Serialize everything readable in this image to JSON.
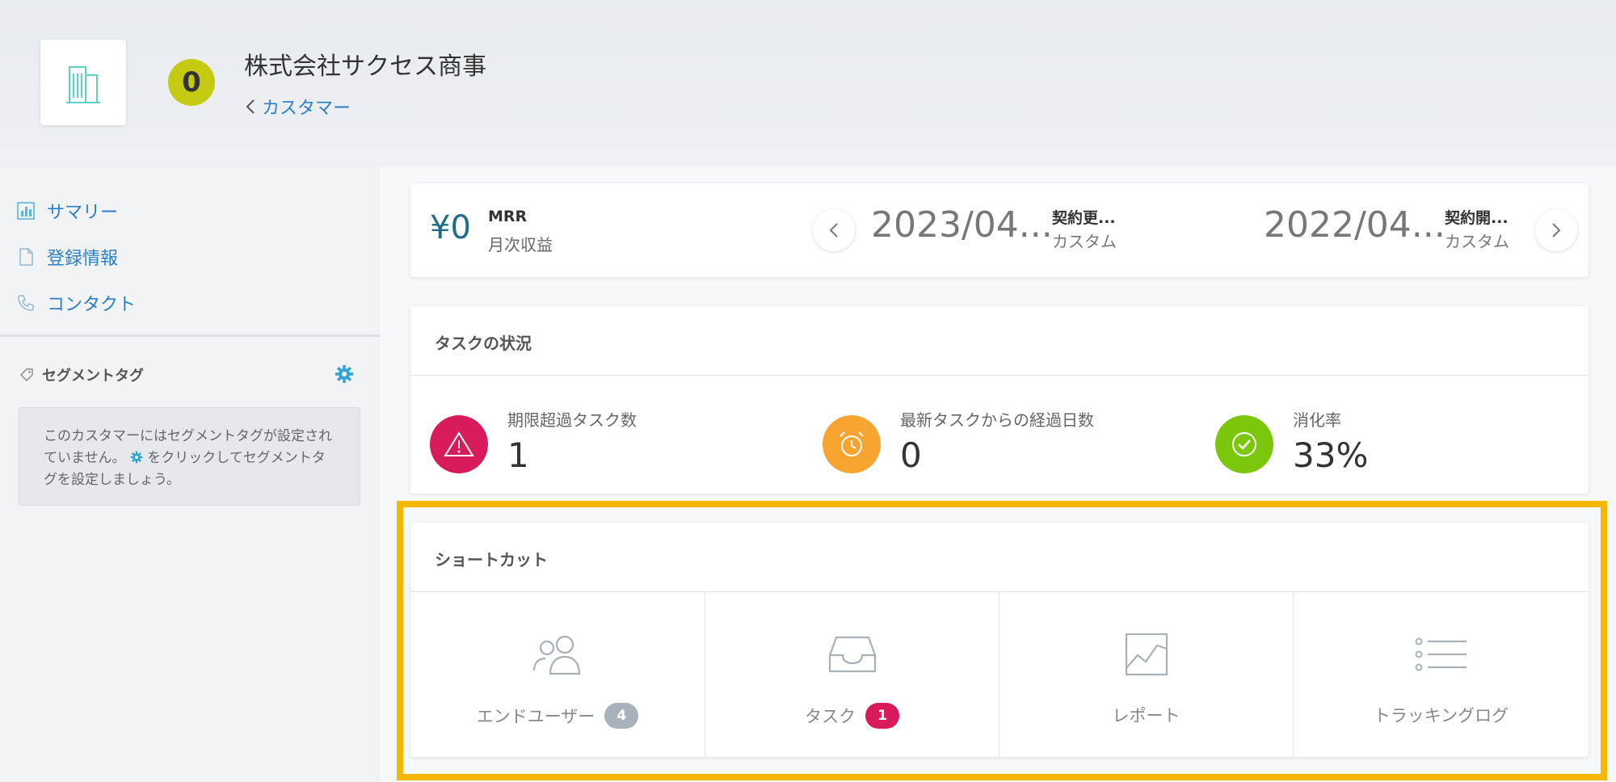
{
  "header": {
    "company_name": "株式会社サクセス商事",
    "score": "0",
    "score_color": "#c5cb12",
    "back_label": "カスタマー"
  },
  "sidebar": {
    "items": [
      {
        "label": "サマリー",
        "icon": "bar-chart-icon"
      },
      {
        "label": "登録情報",
        "icon": "document-icon"
      },
      {
        "label": "コンタクト",
        "icon": "phone-icon"
      }
    ],
    "segment_tag": {
      "title": "セグメントタグ",
      "empty_text_1": "このカスタマーにはセグメントタグが設定されていません。",
      "empty_text_2": "をクリックしてセグメントタグを設定しましょう。"
    }
  },
  "mrr": {
    "value": "¥0",
    "label": "MRR",
    "sub": "月次収益",
    "dates": [
      {
        "date": "2023/04...",
        "label": "契約更...",
        "sub": "カスタム"
      },
      {
        "date": "2022/04...",
        "label": "契約開...",
        "sub": "カスタム"
      }
    ]
  },
  "task_status": {
    "title": "タスクの状況",
    "stats": [
      {
        "label": "期限超過タスク数",
        "value": "1",
        "color": "#d81b5a",
        "icon": "warning-icon"
      },
      {
        "label": "最新タスクからの経過日数",
        "value": "0",
        "color": "#f7a530",
        "icon": "alarm-clock-icon"
      },
      {
        "label": "消化率",
        "value": "33%",
        "color": "#7ac70c",
        "icon": "check-circle-icon"
      }
    ]
  },
  "shortcuts": {
    "title": "ショートカット",
    "items": [
      {
        "label": "エンドユーザー",
        "badge": "4",
        "badge_color": "#a9b2bb",
        "icon": "users-icon"
      },
      {
        "label": "タスク",
        "badge": "1",
        "badge_color": "#d81b5a",
        "icon": "inbox-icon"
      },
      {
        "label": "レポート",
        "icon": "line-chart-icon"
      },
      {
        "label": "トラッキングログ",
        "icon": "list-icon"
      }
    ]
  }
}
